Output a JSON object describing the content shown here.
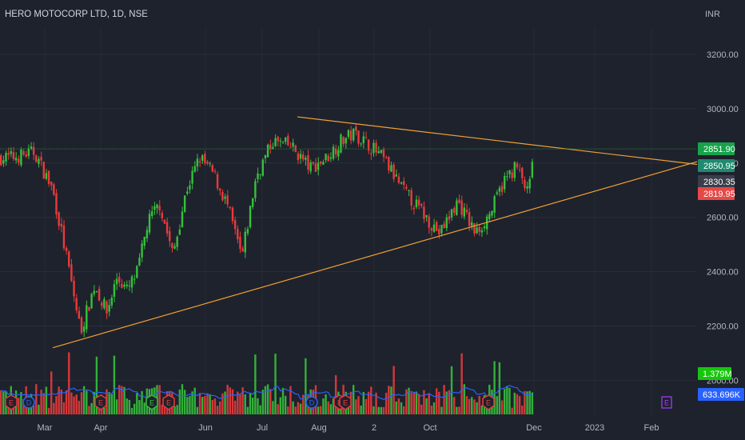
{
  "header": {
    "title": "HERO MOTOCORP LTD, 1D, NSE",
    "currency": "INR"
  },
  "colors": {
    "background": "#1e222d",
    "up": "#26a69a",
    "candle_up": "#35c13b",
    "candle_down": "#e83b3b",
    "trendline": "#f0a032",
    "volume_ma": "#2962ff",
    "last_price_line": "#2e7d32"
  },
  "chart_data": {
    "type": "candlestick",
    "ylim": [
      2080,
      3330
    ],
    "y_ticks": [
      "3200.00",
      "3000.00",
      "2800.00",
      "2600.00",
      "2400.00",
      "2200.00",
      "2000.00"
    ],
    "x_ticks": [
      "Mar",
      "Apr",
      "Jun",
      "Jul",
      "Aug",
      "2",
      "Oct",
      "Dec",
      "2023",
      "Feb"
    ],
    "price_tags": [
      {
        "label": "2851.90",
        "value": 2851.9,
        "color": "#16a34a",
        "text_color": "#ffffff"
      },
      {
        "label": "2850.95",
        "value": 2850.95,
        "color": "#1f8a70",
        "text_color": "#ffffff"
      },
      {
        "label": "2830.35",
        "value": 2830.35,
        "color": "#3a3e4a",
        "text_color": "#ffffff"
      },
      {
        "label": "2819.95",
        "value": 2819.95,
        "color": "#e64848",
        "text_color": "#ffffff"
      }
    ],
    "volume_tags": [
      {
        "label": "1.379M",
        "color": "#16c60c"
      },
      {
        "label": "633.696K",
        "color": "#2962ff"
      }
    ],
    "trendlines": [
      {
        "name": "upper",
        "from": [
          "Jul",
          2970
        ],
        "to": [
          "Dec",
          2810
        ]
      },
      {
        "name": "lower",
        "from": [
          "Mar",
          2120
        ],
        "to": [
          "Dec",
          2580
        ]
      }
    ],
    "close_anchors": [
      [
        "Feb",
        2820
      ],
      [
        "Feb",
        2840
      ],
      [
        "Mar",
        2700
      ],
      [
        "Mar",
        2450
      ],
      [
        "Mar",
        2180
      ],
      [
        "Mar",
        2350
      ],
      [
        "Apr",
        2250
      ],
      [
        "Apr",
        2380
      ],
      [
        "Apr",
        2330
      ],
      [
        "Apr",
        2400
      ],
      [
        "Apr",
        2580
      ],
      [
        "May",
        2650
      ],
      [
        "May",
        2460
      ],
      [
        "May",
        2700
      ],
      [
        "May",
        2820
      ],
      [
        "Jun",
        2760
      ],
      [
        "Jun",
        2640
      ],
      [
        "Jun",
        2450
      ],
      [
        "Jun",
        2750
      ],
      [
        "Jul",
        2880
      ],
      [
        "Jul",
        2860
      ],
      [
        "Jul",
        2780
      ],
      [
        "Aug",
        2820
      ],
      [
        "Aug",
        2880
      ],
      [
        "Aug",
        2910
      ],
      [
        "Aug",
        2870
      ],
      [
        "Sep",
        2810
      ],
      [
        "Sep",
        2700
      ],
      [
        "Sep",
        2620
      ],
      [
        "Oct",
        2540
      ],
      [
        "Oct",
        2660
      ],
      [
        "Oct",
        2540
      ],
      [
        "Nov",
        2620
      ],
      [
        "Nov",
        2730
      ],
      [
        "Nov",
        2790
      ],
      [
        "Nov",
        2680
      ],
      [
        "Dec",
        2851.9
      ]
    ],
    "events": [
      {
        "label": "E",
        "at": "Feb",
        "shape": "diamond",
        "color": "#e83b3b"
      },
      {
        "label": "D",
        "at": "Feb",
        "shape": "circle",
        "color": "#2962ff"
      },
      {
        "label": "E",
        "at": "Apr",
        "shape": "diamond",
        "color": "#e83b3b"
      },
      {
        "label": "E",
        "at": "Jun",
        "shape": "diamond",
        "color": "#35c13b"
      },
      {
        "label": "E",
        "at": "Jun",
        "shape": "diamond",
        "color": "#e83b3b"
      },
      {
        "label": "D",
        "at": "Aug",
        "shape": "circle",
        "color": "#2962ff"
      },
      {
        "label": "E",
        "at": "Aug",
        "shape": "diamond",
        "color": "#e83b3b"
      },
      {
        "label": "E",
        "at": "Aug",
        "shape": "diamond",
        "color": "#e83b3b"
      },
      {
        "label": "E",
        "at": "Nov",
        "shape": "diamond",
        "color": "#e83b3b"
      },
      {
        "label": "E",
        "at": "Feb",
        "shape": "square",
        "color": "#a63cff"
      }
    ]
  }
}
